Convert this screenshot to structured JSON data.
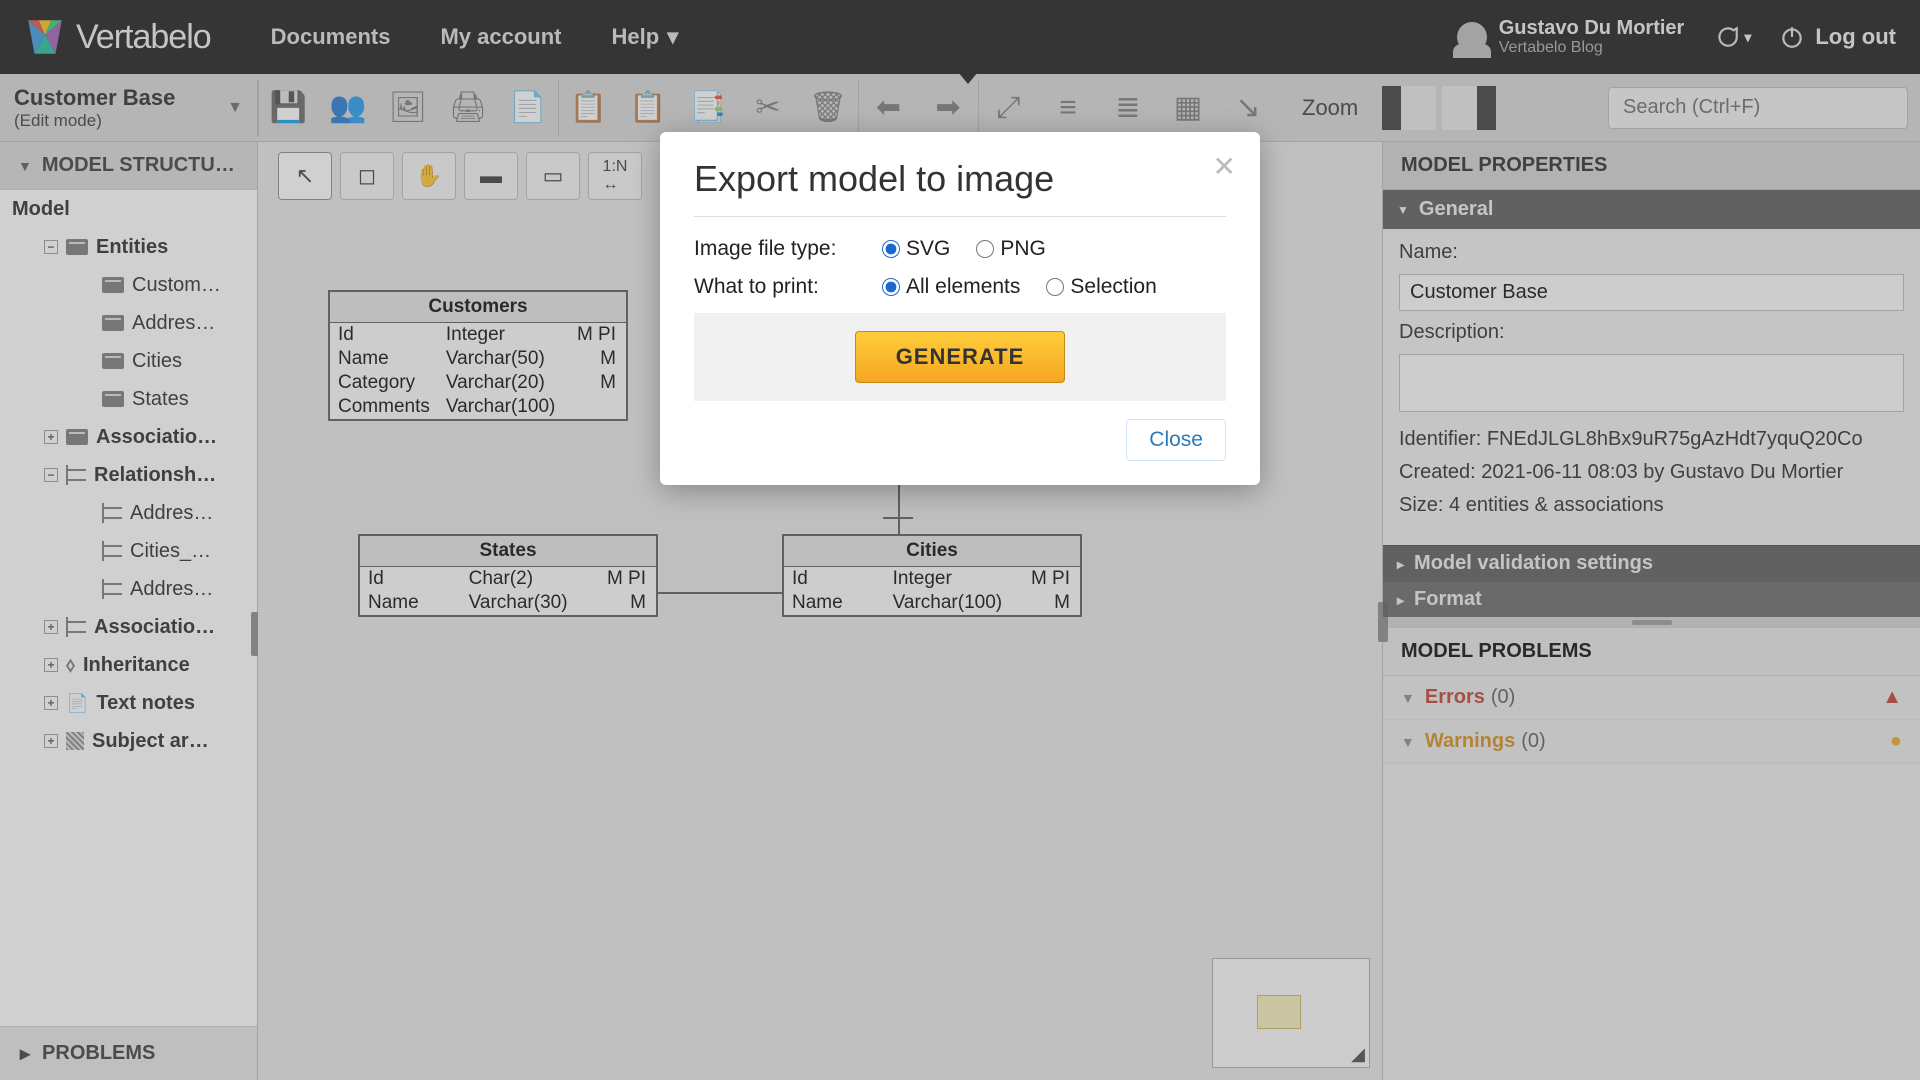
{
  "brand": "Vertabelo",
  "topnav": {
    "documents": "Documents",
    "account": "My account",
    "help": "Help"
  },
  "user": {
    "name": "Gustavo Du Mortier",
    "sub": "Vertabelo Blog"
  },
  "logout": "Log out",
  "doc": {
    "title": "Customer Base",
    "mode": "(Edit mode)"
  },
  "zoom_label": "Zoom",
  "search_placeholder": "Search (Ctrl+F)",
  "sidebar": {
    "structure_header": "MODEL STRUCTU…",
    "root": "Model",
    "entities_label": "Entities",
    "entities": [
      "Custom…",
      "Addres…",
      "Cities",
      "States"
    ],
    "associations_label": "Associatio…",
    "relationships_label": "Relationsh…",
    "relationships": [
      "Addres…",
      "Cities_…",
      "Addres…"
    ],
    "assoc2_label": "Associatio…",
    "inheritance_label": "Inheritance",
    "textnotes_label": "Text notes",
    "subject_label": "Subject ar…",
    "problems_label": "PROBLEMS"
  },
  "entities": {
    "customers": {
      "title": "Customers",
      "rows": [
        {
          "n": "Id",
          "t": "Integer",
          "f": "M PI"
        },
        {
          "n": "Name",
          "t": "Varchar(50)",
          "f": "M"
        },
        {
          "n": "Category",
          "t": "Varchar(20)",
          "f": "M"
        },
        {
          "n": "Comments",
          "t": "Varchar(100)",
          "f": ""
        }
      ]
    },
    "states": {
      "title": "States",
      "rows": [
        {
          "n": "Id",
          "t": "Char(2)",
          "f": "M PI"
        },
        {
          "n": "Name",
          "t": "Varchar(30)",
          "f": "M"
        }
      ]
    },
    "cities": {
      "title": "Cities",
      "rows": [
        {
          "n": "Id",
          "t": "Integer",
          "f": "M PI"
        },
        {
          "n": "Name",
          "t": "Varchar(100)",
          "f": "M"
        }
      ]
    }
  },
  "props": {
    "header": "MODEL PROPERTIES",
    "general": "General",
    "name_label": "Name:",
    "name_value": "Customer Base",
    "desc_label": "Description:",
    "identifier": "Identifier: FNEdJLGL8hBx9uR75gAzHdt7yquQ20Co",
    "created": "Created: 2021-06-11 08:03 by Gustavo Du Mortier",
    "size": "Size: 4 entities & associations",
    "validation": "Model validation settings",
    "format": "Format"
  },
  "problems": {
    "header": "MODEL PROBLEMS",
    "errors_label": "Errors",
    "errors_count": "(0)",
    "warnings_label": "Warnings",
    "warnings_count": "(0)"
  },
  "modal": {
    "title": "Export model to image",
    "filetype_label": "Image file type:",
    "svg": "SVG",
    "png": "PNG",
    "print_label": "What to print:",
    "all": "All elements",
    "selection": "Selection",
    "generate": "GENERATE",
    "close": "Close"
  }
}
